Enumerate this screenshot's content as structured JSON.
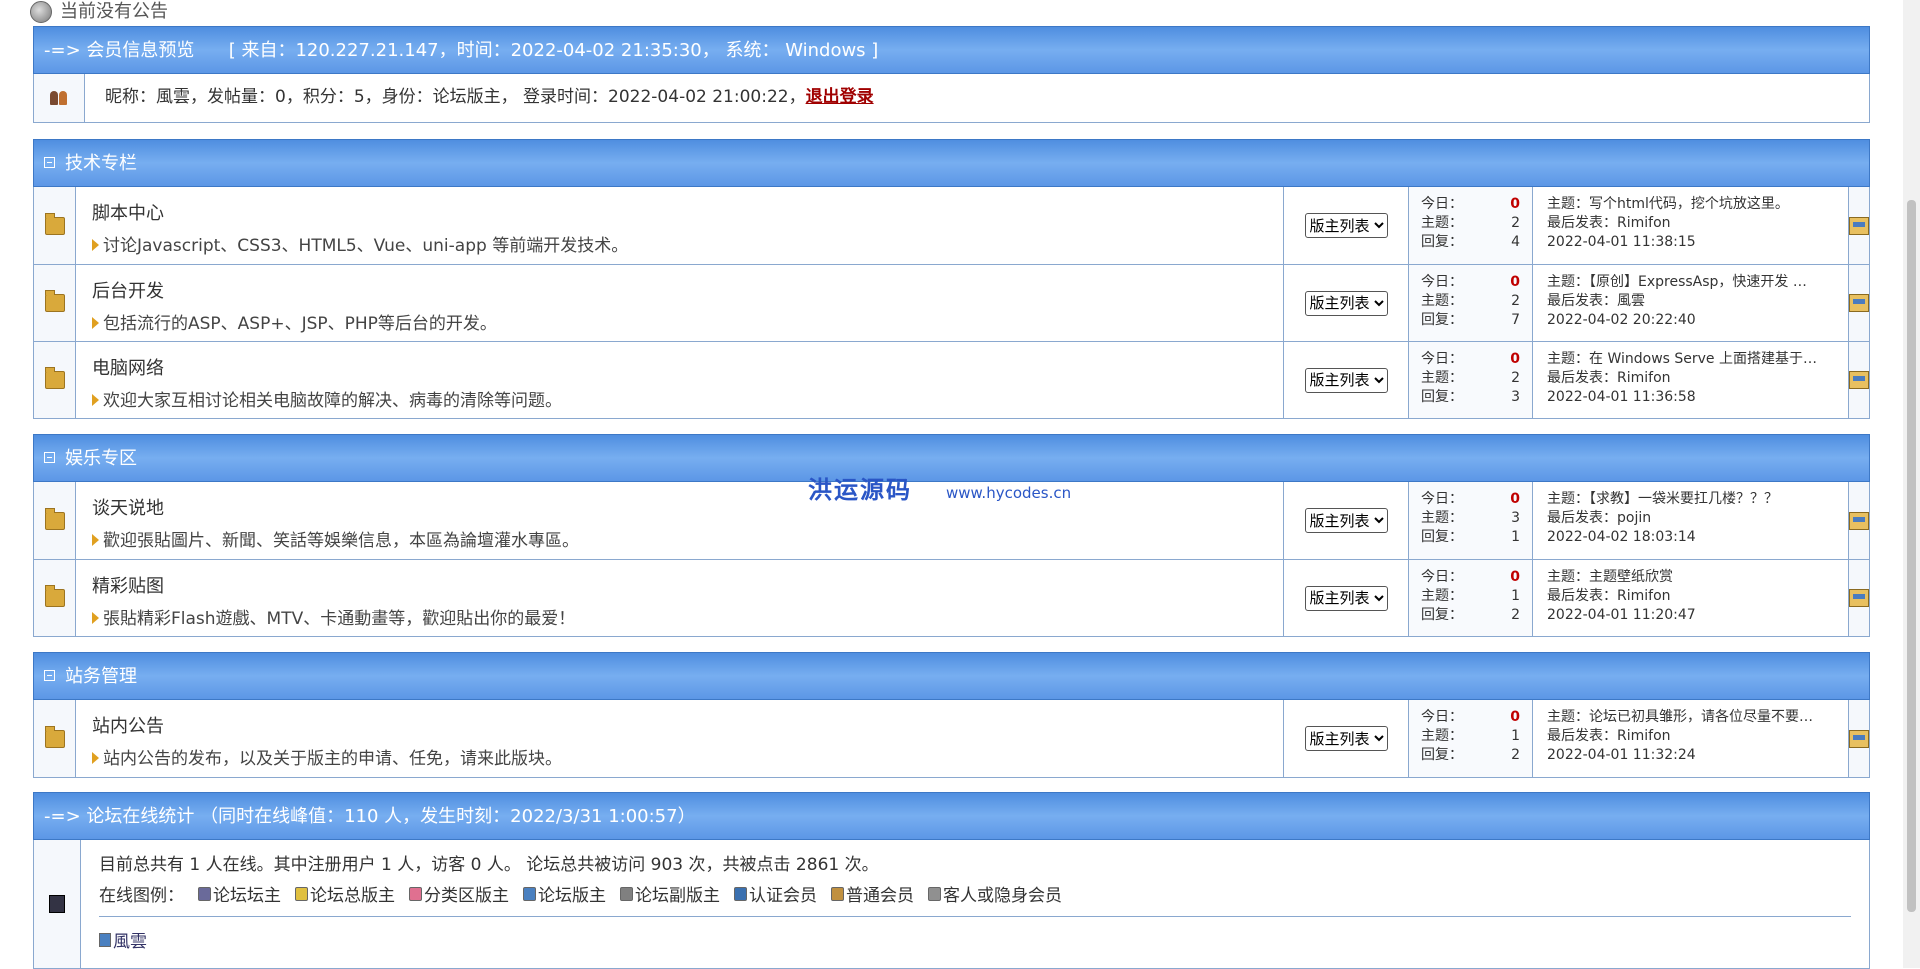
{
  "announcement": "当前没有公告",
  "member_preview": {
    "header": "-=> 会员信息预览      [ 来自：120.227.21.147，时间：2022-04-02 21:35:30， 系统： Windows ]",
    "info": "昵称：風雲，发帖量：0，积分：5，身份：论坛版主， 登录时间：2022-04-02 21:00:22，",
    "logout": "退出登录"
  },
  "moderator_select": "版主列表",
  "stat_labels": {
    "today": "今日：",
    "topics": "主题：",
    "replies": "回复："
  },
  "categories": [
    {
      "name": "技术专栏",
      "forums": [
        {
          "title": "脚本中心",
          "desc": "讨论Javascript、CSS3、HTML5、Vue、uni-app 等前端开发技术。",
          "today": "0",
          "topics": "2",
          "replies": "4",
          "last_topic": "主题：写个html代码，挖个坑放这里。",
          "last_poster": "最后发表：Rimifon",
          "last_time": "2022-04-01 11:38:15"
        },
        {
          "title": "后台开发",
          "desc": "包括流行的ASP、ASP+、JSP、PHP等后台的开发。",
          "today": "0",
          "topics": "2",
          "replies": "7",
          "last_topic": "主题：【原创】ExpressAsp，快速开发 …",
          "last_poster": "最后发表：風雲",
          "last_time": "2022-04-02 20:22:40"
        },
        {
          "title": "电脑网络",
          "desc": "欢迎大家互相讨论相关电脑故障的解决、病毒的清除等问题。",
          "today": "0",
          "topics": "2",
          "replies": "3",
          "last_topic": "主题：在 Windows Serve 上面搭建基于…",
          "last_poster": "最后发表：Rimifon",
          "last_time": "2022-04-01 11:36:58"
        }
      ]
    },
    {
      "name": "娱乐专区",
      "forums": [
        {
          "title": "谈天说地",
          "desc": "歡迎張貼圖片、新聞、笑話等娛樂信息，本區為論壇灌水專區。",
          "today": "0",
          "topics": "3",
          "replies": "1",
          "last_topic": "主题：【求教】一袋米要扛几楼？？？",
          "last_poster": "最后发表：pojin",
          "last_time": "2022-04-02 18:03:14"
        },
        {
          "title": "精彩贴图",
          "desc": "張貼精彩Flash遊戲、MTV、卡通動畫等，歡迎貼出你的最爱！",
          "today": "0",
          "topics": "1",
          "replies": "2",
          "last_topic": "主题：主题壁纸欣赏",
          "last_poster": "最后发表：Rimifon",
          "last_time": "2022-04-01 11:20:47"
        }
      ]
    },
    {
      "name": "站务管理",
      "forums": [
        {
          "title": "站内公告",
          "desc": "站内公告的发布，以及关于版主的申请、任免，请来此版块。",
          "today": "0",
          "topics": "1",
          "replies": "2",
          "last_topic": "主题：论坛已初具雏形，请各位尽量不要…",
          "last_poster": "最后发表：Rimifon",
          "last_time": "2022-04-01 11:32:24"
        }
      ]
    }
  ],
  "watermark": {
    "cn": "洪运源码",
    "url": "www.hycodes.cn"
  },
  "online": {
    "header": "-=> 论坛在线统计 （同时在线峰值：110 人，发生时刻：2022/3/31 1:00:57）",
    "summary": "目前总共有 1 人在线。其中注册用户 1 人，访客 0 人。 论坛总共被访问 903 次，共被点击 2861 次。",
    "legend_label": "在线图例：",
    "legend": [
      {
        "label": "论坛坛主",
        "color": "#6a6a9a"
      },
      {
        "label": "论坛总版主",
        "color": "#e0c040"
      },
      {
        "label": "分类区版主",
        "color": "#e07090"
      },
      {
        "label": "论坛版主",
        "color": "#4a80c0"
      },
      {
        "label": "论坛副版主",
        "color": "#808080"
      },
      {
        "label": "认证会员",
        "color": "#3a70b0"
      },
      {
        "label": "普通会员",
        "color": "#c09040"
      },
      {
        "label": "客人或隐身会员",
        "color": "#909090"
      }
    ],
    "users": [
      "風雲"
    ]
  }
}
